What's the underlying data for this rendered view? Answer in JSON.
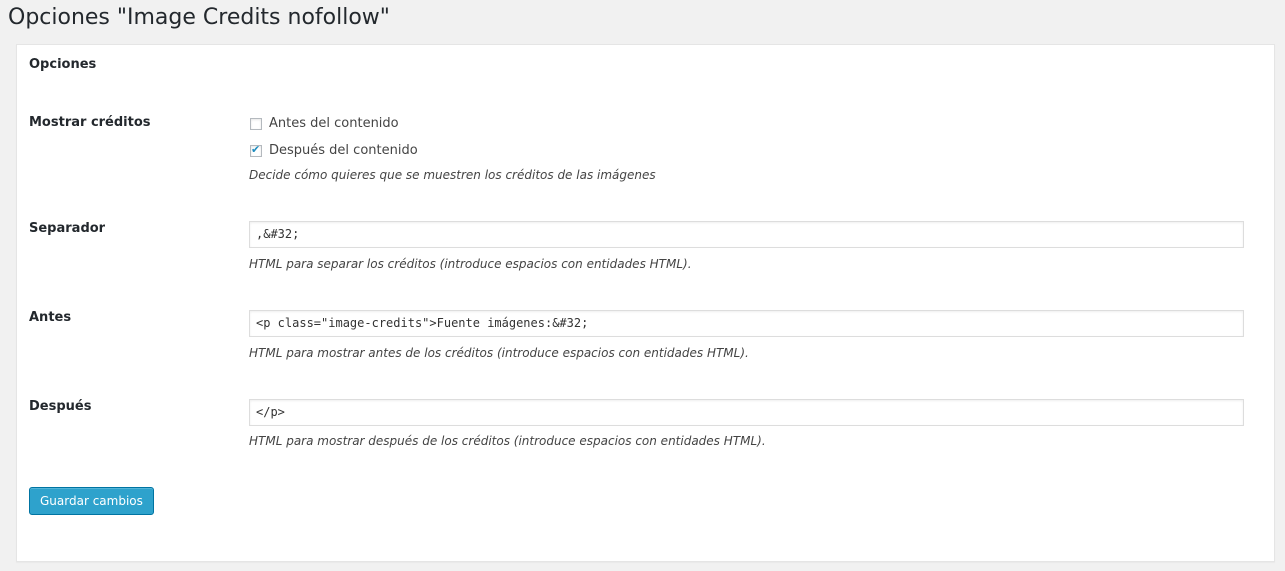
{
  "page": {
    "title": "Opciones \"Image Credits nofollow\""
  },
  "section": {
    "title": "Opciones"
  },
  "fields": {
    "mostrar": {
      "label": "Mostrar créditos",
      "options": [
        {
          "label": "Antes del contenido",
          "checked": false
        },
        {
          "label": "Después del contenido",
          "checked": true
        }
      ],
      "description": "Decide cómo quieres que se muestren los créditos de las imágenes"
    },
    "separador": {
      "label": "Separador",
      "value": ",&#32;",
      "description": "HTML para separar los créditos (introduce espacios con entidades HTML)."
    },
    "antes": {
      "label": "Antes",
      "value": "<p class=\"image-credits\">Fuente imágenes:&#32;",
      "description": "HTML para mostrar antes de los créditos (introduce espacios con entidades HTML)."
    },
    "despues": {
      "label": "Después",
      "value": "</p>",
      "description": "HTML para mostrar después de los créditos (introduce espacios con entidades HTML)."
    }
  },
  "actions": {
    "save_label": "Guardar cambios"
  },
  "colors": {
    "button_bg": "#2ea2cc",
    "button_border": "#0074a2",
    "checkmark": "#1e8cbe",
    "page_bg": "#f1f1f1"
  }
}
